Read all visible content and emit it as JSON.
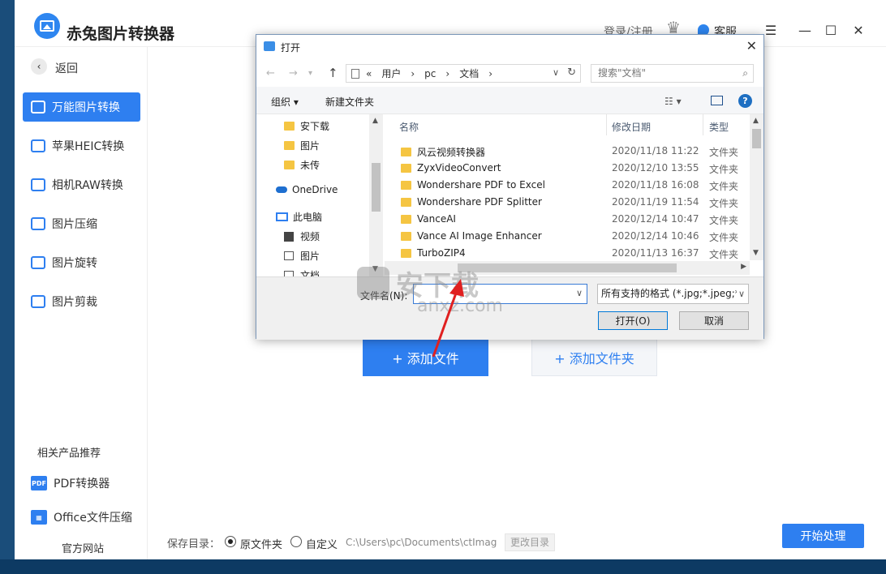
{
  "app": {
    "title": "赤兔图片转换器",
    "login": "登录/注册",
    "support": "客服"
  },
  "sidebar": {
    "back": "返回",
    "items": [
      {
        "label": "万能图片转换",
        "active": true
      },
      {
        "label": "苹果HEIC转换",
        "active": false
      },
      {
        "label": "相机RAW转换",
        "active": false
      },
      {
        "label": "图片压缩",
        "active": false
      },
      {
        "label": "图片旋转",
        "active": false
      },
      {
        "label": "图片剪裁",
        "active": false
      }
    ],
    "related_title": "相关产品推荐",
    "related": [
      {
        "icon": "PDF",
        "label": "PDF转换器"
      },
      {
        "icon": "",
        "label": "Office文件压缩"
      }
    ],
    "official_site": "官方网站"
  },
  "main": {
    "add_file": "+ 添加文件",
    "add_folder": "+ 添加文件夹",
    "save_dir_label": "保存目录：",
    "radio_original": "原文件夹",
    "radio_custom": "自定义",
    "path": "C:\\Users\\pc\\Documents\\ctImag",
    "change_dir": "更改目录",
    "start": "开始处理"
  },
  "dialog": {
    "title": "打开",
    "address": [
      "«",
      "用户",
      "›",
      "pc",
      "›",
      "文档",
      "›"
    ],
    "search_placeholder": "搜索\"文档\"",
    "organize": "组织 ▾",
    "new_folder": "新建文件夹",
    "tree": [
      {
        "label": "安下载",
        "icon": "folder"
      },
      {
        "label": "图片",
        "icon": "folder"
      },
      {
        "label": "未传",
        "icon": "folder"
      },
      {
        "label": "OneDrive",
        "icon": "cloud"
      },
      {
        "label": "此电脑",
        "icon": "pc"
      },
      {
        "label": "视频",
        "icon": "video"
      },
      {
        "label": "图片",
        "icon": "pics"
      },
      {
        "label": "文档",
        "icon": "pics"
      }
    ],
    "columns": {
      "name": "名称",
      "date": "修改日期",
      "type": "类型"
    },
    "files": [
      {
        "name": "风云视频转换器",
        "date": "2020/11/18 11:22",
        "type": "文件夹"
      },
      {
        "name": "ZyxVideoConvert",
        "date": "2020/12/10 13:55",
        "type": "文件夹"
      },
      {
        "name": "Wondershare PDF to Excel",
        "date": "2020/11/18 16:08",
        "type": "文件夹"
      },
      {
        "name": "Wondershare PDF Splitter",
        "date": "2020/11/19 11:54",
        "type": "文件夹"
      },
      {
        "name": "VanceAI",
        "date": "2020/12/14 10:47",
        "type": "文件夹"
      },
      {
        "name": "Vance AI Image Enhancer",
        "date": "2020/12/14 10:46",
        "type": "文件夹"
      },
      {
        "name": "TurboZIP4",
        "date": "2020/11/13 16:37",
        "type": "文件夹"
      }
    ],
    "filename_label": "文件名(N):",
    "filename_value": "",
    "filter": "所有支持的格式 (*.jpg;*.jpeg;*",
    "open": "打开(O)",
    "cancel": "取消"
  },
  "watermark": {
    "text": "安下载",
    "sub": "anxz.com"
  },
  "colors": {
    "accent": "#2e7ff0",
    "arrow": "#e02020"
  }
}
